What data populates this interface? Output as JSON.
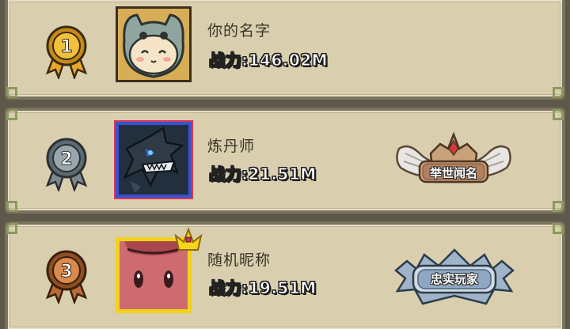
{
  "rankings": [
    {
      "rank": "1",
      "name": "你的名字",
      "power": "战力:146.02M",
      "medal": {
        "fill": "#f2c13c",
        "ring": "#c68a1a",
        "ribbon": "#e9a62a"
      },
      "avatar": "cat-hood-avatar",
      "title_badge": null
    },
    {
      "rank": "2",
      "name": "炼丹师",
      "power": "战力:21.51M",
      "medal": {
        "fill": "#9aa6ad",
        "ring": "#5f6b72",
        "ribbon": "#7d888e"
      },
      "avatar": "dark-dragon-avatar",
      "title_badge": {
        "label": "举世闻名",
        "icon": "winged-crown-badge-icon"
      }
    },
    {
      "rank": "3",
      "name": "随机昵称",
      "power": "战力:19.51M",
      "medal": {
        "fill": "#d98a4d",
        "ring": "#8d4f22",
        "ribbon": "#b86d36"
      },
      "avatar": "red-block-avatar",
      "title_badge": {
        "label": "忠实玩家",
        "icon": "silver-shield-badge-icon"
      }
    }
  ]
}
